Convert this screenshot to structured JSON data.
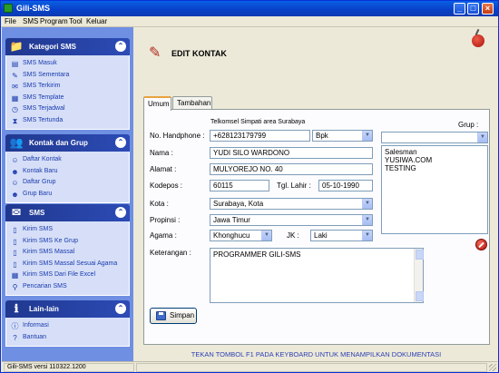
{
  "window": {
    "title": "Gili-SMS"
  },
  "menu": [
    "File",
    "SMS",
    "Program",
    "Tool",
    "Keluar"
  ],
  "sidebar": {
    "panels": [
      {
        "title": "Kategori SMS",
        "icon": "folder-icon",
        "items": [
          {
            "label": "SMS Masuk",
            "icon": "inbox-icon"
          },
          {
            "label": "SMS Sementara",
            "icon": "draft-icon"
          },
          {
            "label": "SMS Terkirim",
            "icon": "sent-icon"
          },
          {
            "label": "SMS Template",
            "icon": "template-icon"
          },
          {
            "label": "SMS Terjadwal",
            "icon": "schedule-icon"
          },
          {
            "label": "SMS Tertunda",
            "icon": "pending-icon"
          }
        ]
      },
      {
        "title": "Kontak dan Grup",
        "icon": "contacts-icon",
        "items": [
          {
            "label": "Daftar Kontak",
            "icon": "contact-list-icon"
          },
          {
            "label": "Kontak Baru",
            "icon": "new-contact-icon"
          },
          {
            "label": "Daftar Grup",
            "icon": "group-list-icon"
          },
          {
            "label": "Grup Baru",
            "icon": "new-group-icon"
          }
        ]
      },
      {
        "title": "SMS",
        "icon": "envelope-icon",
        "items": [
          {
            "label": "Kirim SMS",
            "icon": "send-icon"
          },
          {
            "label": "Kirim SMS Ke Grup",
            "icon": "send-group-icon"
          },
          {
            "label": "Kirim SMS Massal",
            "icon": "send-mass-icon"
          },
          {
            "label": "Kirim SMS Massal Sesuai Agama",
            "icon": "send-religion-icon"
          },
          {
            "label": "Kirim SMS Dari File Excel",
            "icon": "excel-icon"
          },
          {
            "label": "Pencarian SMS",
            "icon": "search-icon"
          }
        ]
      },
      {
        "title": "Lain-lain",
        "icon": "info-book-icon",
        "items": [
          {
            "label": "Informasi",
            "icon": "info-icon"
          },
          {
            "label": "Bantuan",
            "icon": "help-icon"
          }
        ]
      }
    ]
  },
  "page": {
    "title": "EDIT KONTAK",
    "tabs": [
      "Umum",
      "Tambahan"
    ],
    "operator_hint": "Telkomsel Simpati area Surabaya",
    "labels": {
      "phone": "No. Handphone :",
      "name": "Nama :",
      "address": "Alamat :",
      "postal": "Kodepos :",
      "birthdate": "Tgl. Lahir :",
      "city": "Kota :",
      "province": "Propinsi :",
      "religion": "Agama :",
      "gender": "JK :",
      "notes": "Keterangan :",
      "group": "Grup :"
    },
    "values": {
      "phone": "+628123179799",
      "title": "Bpk",
      "name": "YUDI SILO WARDONO",
      "address": "MULYOREJO NO. 40",
      "postal": "60115",
      "birthdate": "05-10-1990",
      "city": "Surabaya, Kota",
      "province": "Jawa Timur",
      "religion": "Khonghucu",
      "gender": "Laki",
      "notes": "PROGRAMMER GILI-SMS",
      "group_select": ""
    },
    "groups": [
      "Salesman",
      "YUSIWA.COM",
      "TESTING"
    ],
    "save_label": "Simpan",
    "footer_hint": "TEKAN TOMBOL F1 PADA KEYBOARD UNTUK MENAMPILKAN DOKUMENTASI"
  },
  "status": {
    "version": "Gili-SMS versi 110322.1200"
  },
  "colors": {
    "titlebar": "#0A5FE3",
    "sidebar": "#6F8FE2",
    "panel_header": "#2C4BB5",
    "link": "#1A3AAE",
    "hint": "#2C3FB3"
  }
}
